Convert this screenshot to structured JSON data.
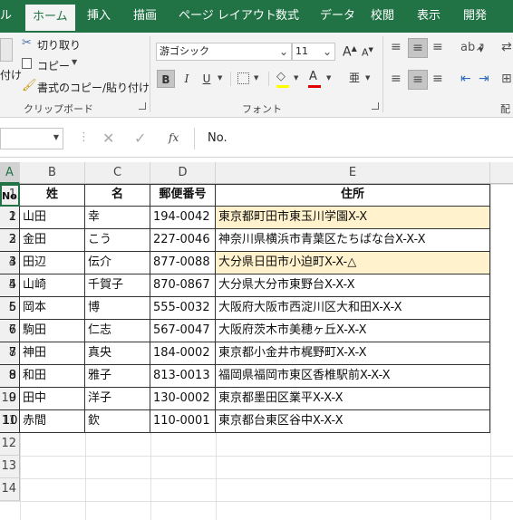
{
  "ribbon_tabs": [
    "ル",
    "ホーム",
    "挿入",
    "描画",
    "ページ レイアウト",
    "数式",
    "データ",
    "校閲",
    "表示",
    "開発"
  ],
  "clipboard": {
    "cut": "切り取り",
    "copy": "コピー",
    "format_painter": "書式のコピー/貼り付け",
    "paste_partial": "付け",
    "group_label": "クリップボード"
  },
  "font": {
    "name": "游ゴシック",
    "size": "11",
    "grow": "A",
    "shrink": "A",
    "bold": "B",
    "italic": "I",
    "underline": "U",
    "group_label": "フォント"
  },
  "alignment": {
    "group_label_partial": "配"
  },
  "formula_bar": {
    "name_box": "",
    "fx": "fx",
    "content": "No."
  },
  "columns": [
    "A",
    "B",
    "C",
    "D",
    "E"
  ],
  "table": {
    "headers": [
      "No.",
      "姓",
      "名",
      "郵便番号",
      "住所"
    ],
    "rows": [
      {
        "no": "1",
        "sei": "山田",
        "mei": "幸",
        "zip": "194-0042",
        "addr": "東京都町田市東玉川学園X-X",
        "highlight": true
      },
      {
        "no": "2",
        "sei": "金田",
        "mei": "こう",
        "zip": "227-0046",
        "addr": "神奈川県横浜市青葉区たちばな台X-X-X",
        "highlight": false
      },
      {
        "no": "3",
        "sei": "田辺",
        "mei": "伝介",
        "zip": "877-0088",
        "addr": "大分県日田市小迫町X-X-△",
        "highlight": true
      },
      {
        "no": "4",
        "sei": "山崎",
        "mei": "千賀子",
        "zip": "870-0867",
        "addr": "大分県大分市東野台X-X-X",
        "highlight": false
      },
      {
        "no": "5",
        "sei": "岡本",
        "mei": "博",
        "zip": "555-0032",
        "addr": "大阪府大阪市西淀川区大和田X-X-X",
        "highlight": false
      },
      {
        "no": "6",
        "sei": "駒田",
        "mei": "仁志",
        "zip": "567-0047",
        "addr": "大阪府茨木市美穂ヶ丘X-X-X",
        "highlight": false
      },
      {
        "no": "7",
        "sei": "神田",
        "mei": "真央",
        "zip": "184-0002",
        "addr": "東京都小金井市梶野町X-X-X",
        "highlight": false
      },
      {
        "no": "8",
        "sei": "和田",
        "mei": "雅子",
        "zip": "813-0013",
        "addr": "福岡県福岡市東区香椎駅前X-X-X",
        "highlight": false
      },
      {
        "no": "9",
        "sei": "田中",
        "mei": "洋子",
        "zip": "130-0002",
        "addr": "東京都墨田区業平X-X-X",
        "highlight": false
      },
      {
        "no": "10",
        "sei": "赤間",
        "mei": "欽",
        "zip": "110-0001",
        "addr": "東京都台東区谷中X-X-X",
        "highlight": false
      }
    ]
  },
  "colors": {
    "excel_green": "#217346",
    "highlight_fill": "#fff2cc",
    "font_color_bar": "#e00000"
  }
}
